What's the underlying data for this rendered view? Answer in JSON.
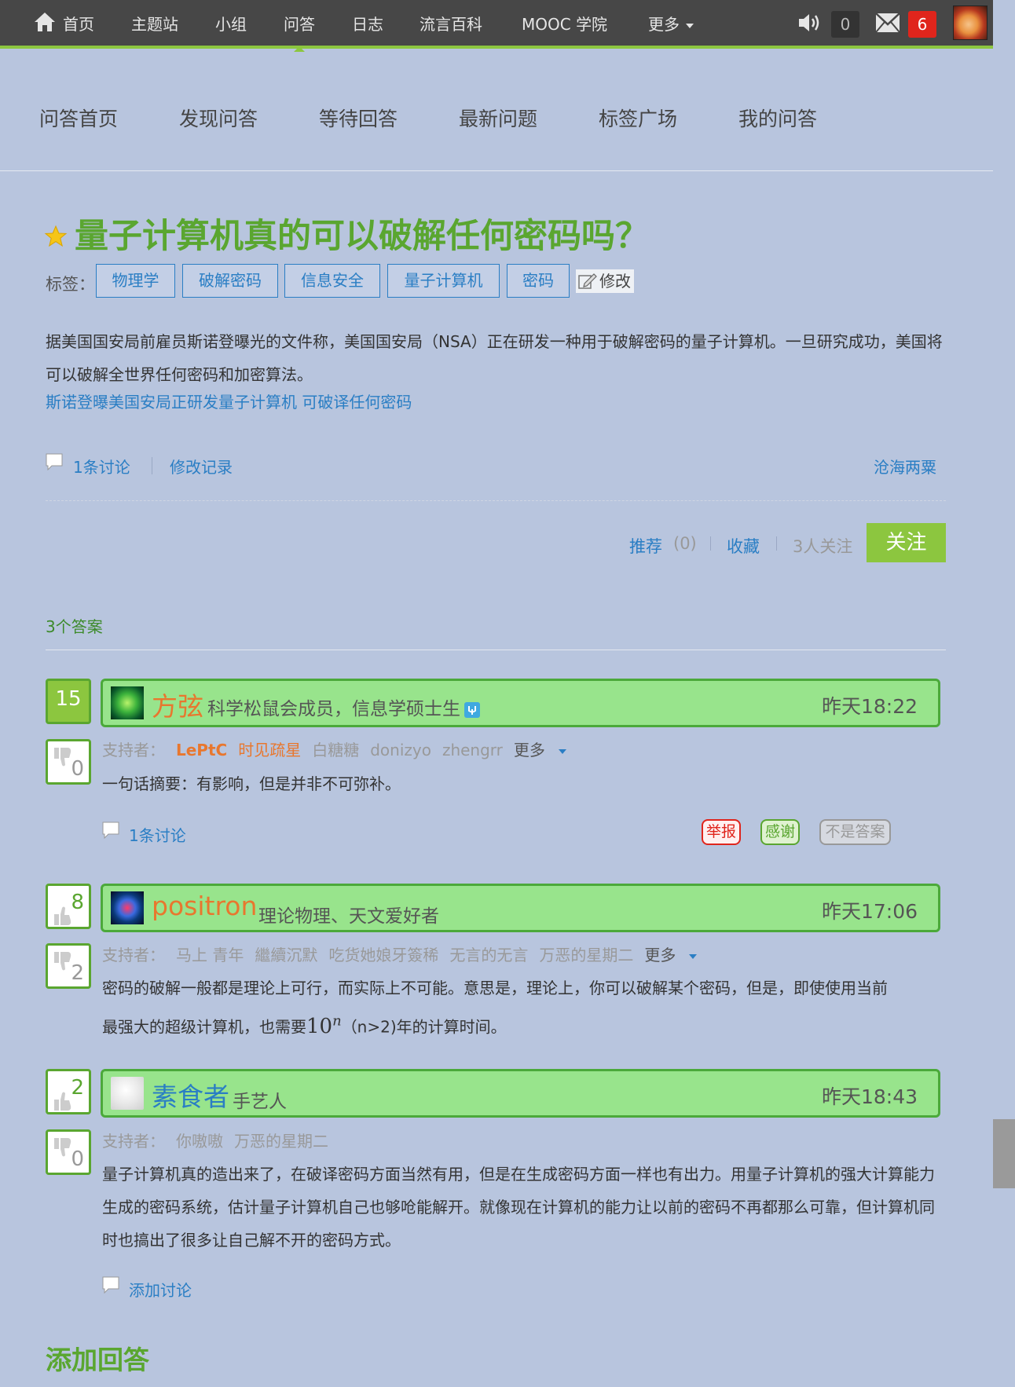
{
  "nav": {
    "items": [
      "首页",
      "主题站",
      "小组",
      "问答",
      "日志",
      "流言百科",
      "MOOC 学院",
      "更多"
    ],
    "notice_count": "0",
    "mail_count": "6"
  },
  "subnav": [
    "问答首页",
    "发现问答",
    "等待回答",
    "最新问题",
    "标签广场",
    "我的问答"
  ],
  "question": {
    "title": "量子计算机真的可以破解任何密码吗？",
    "tags_label": "标签：",
    "tags": [
      "物理学",
      "破解密码",
      "信息安全",
      "量子计算机",
      "密码"
    ],
    "edit_label": "修改",
    "body": "据美国国安局前雇员斯诺登曝光的文件称，美国国安局（NSA）正在研发一种用于破解密码的量子计算机。一旦研究成功，美国将可以破解全世界任何密码和加密算法。",
    "link": "斯诺登曝美国安局正研发量子计算机 可破译任何密码",
    "discussion": "1条讨论",
    "history": "修改记录",
    "asker": "沧海两粟",
    "recommend": "推荐",
    "recommend_count": "(0)",
    "collect": "收藏",
    "followers": "3人关注",
    "follow_btn": "关注"
  },
  "answers_count": "3个答案",
  "answers": [
    {
      "votes": "15",
      "down": "0",
      "author": "方弦",
      "bio": "科学松鼠会成员，信息学硕士生",
      "time": "昨天18:22",
      "supporters_label": "支持者：",
      "supporters": [
        "LePtC",
        "时见疏星",
        "白糖糖",
        "donizyo",
        "zhengrr"
      ],
      "more": "更多",
      "body": "一句话摘要：有影响，但是并非不可弥补。",
      "discussion": "1条讨论",
      "report": "举报",
      "thanks": "感谢",
      "not_answer": "不是答案"
    },
    {
      "votes": "8",
      "down": "2",
      "author": "positron",
      "bio": "理论物理、天文爱好者",
      "time": "昨天17:06",
      "supporters_label": "支持者：",
      "supporters": [
        "马上 青年",
        "繼續沉默",
        "吃货她娘牙簽稀",
        "无言的无言",
        "万恶的星期二"
      ],
      "more": "更多",
      "body_line1": "密码的破解一般都是理论上可行，而实际上不可能。意思是，理论上，你可以破解某个密码，但是，即使使用当前",
      "body_line2a": "最强大的超级计算机，也需要",
      "body_math": "10",
      "body_exp": "n",
      "body_line2b": "（n>2)年的计算时间。"
    },
    {
      "votes": "2",
      "down": "0",
      "author": "素食者",
      "bio": "手艺人",
      "time": "昨天18:43",
      "supporters_label": "支持者：",
      "supporters": [
        "你嗷嗷",
        "万恶的星期二"
      ],
      "body": "量子计算机真的造出来了，在破译密码方面当然有用，但是在生成密码方面一样也有出力。用量子计算机的强大计算能力生成的密码系统，估计量子计算机自己也够呛能解开。就像现在计算机的能力让以前的密码不再都那么可靠，但计算机同时也搞出了很多让自己解不开的密码方式。",
      "add_discussion": "添加讨论"
    }
  ],
  "add_answer": "添加回答"
}
